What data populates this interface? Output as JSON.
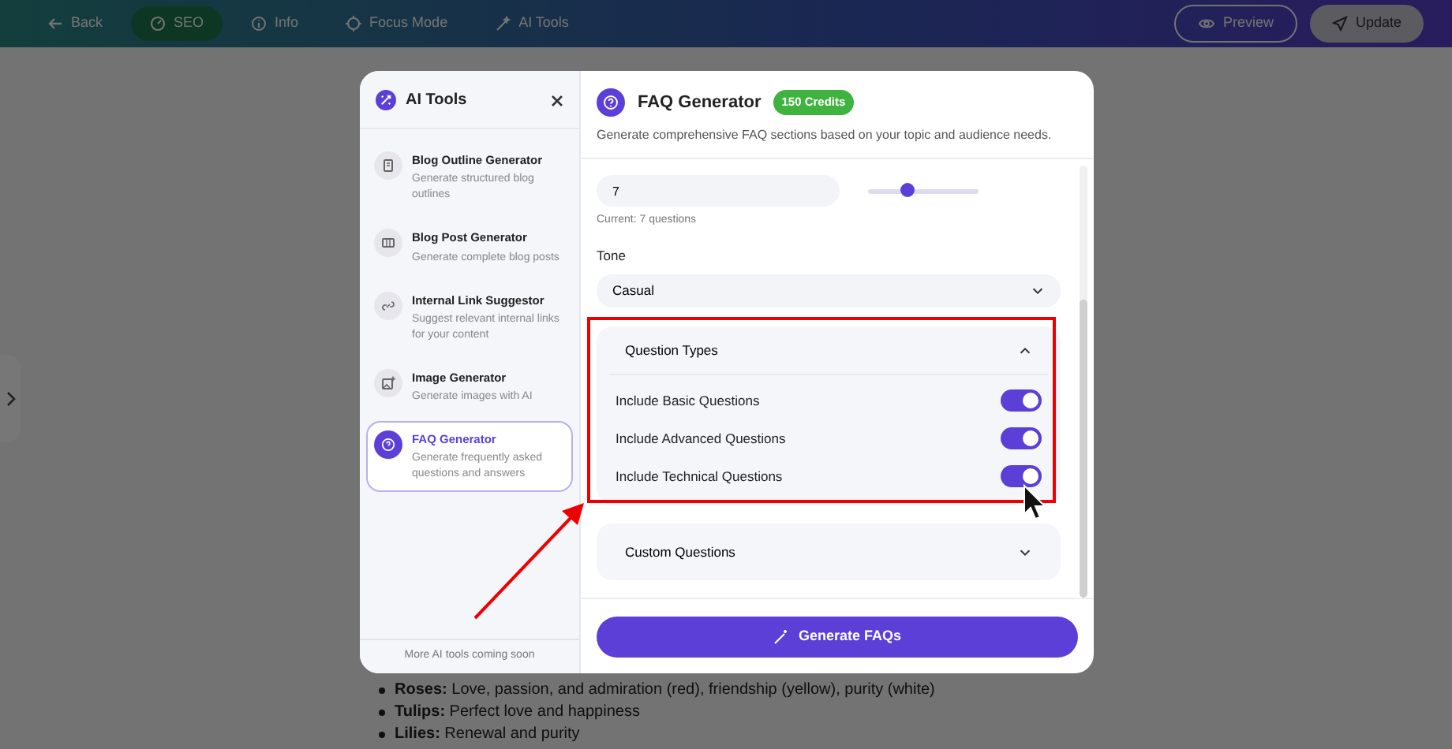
{
  "topbar": {
    "items": [
      {
        "label": "Back",
        "kind": "back",
        "selected": false
      },
      {
        "label": "SEO",
        "kind": "gauge",
        "selected": true
      },
      {
        "label": "Info",
        "kind": "info",
        "selected": false
      },
      {
        "label": "Focus Mode",
        "kind": "focus",
        "selected": false
      },
      {
        "label": "AI Tools",
        "kind": "wand",
        "selected": false
      }
    ],
    "preview": "Preview",
    "update": "Update"
  },
  "document": {
    "bullets": [
      "**Roses:** Love, passion, and admiration (red), friendship (yellow), purity (white)",
      "**Tulips:** Perfect love and happiness",
      "**Lilies:** Renewal and purity"
    ]
  },
  "ai_tools": {
    "title": "AI Tools",
    "tools": [
      {
        "title": "Blog Outline Generator",
        "description": "Generate structured blog outlines",
        "kind": "outline",
        "selected": false
      },
      {
        "title": "Blog Post Generator",
        "description": "Generate complete blog posts",
        "kind": "post",
        "selected": false
      },
      {
        "title": "Internal Link Suggestor",
        "description": "Suggest relevant internal links for your content",
        "kind": "link",
        "selected": false
      },
      {
        "title": "Image Generator",
        "description": "Generate images with AI",
        "kind": "image",
        "selected": false
      },
      {
        "title": "FAQ Generator",
        "description": "Generate frequently asked questions and answers",
        "kind": "faq",
        "selected": true
      }
    ],
    "footer": "More AI tools coming soon"
  },
  "faq": {
    "title": "FAQ Generator",
    "badge": "150 Credits",
    "description": "Generate comprehensive FAQ sections based on your topic and audience needs.",
    "count": {
      "value": "7",
      "level": 0.36,
      "hint": "Current: 7 questions"
    },
    "tone": {
      "label": "Tone",
      "value": "Casual"
    },
    "sections": [
      {
        "title": "Question Types",
        "expanded": true,
        "options": [
          {
            "label": "Include Basic Questions",
            "on": true
          },
          {
            "label": "Include Advanced Questions",
            "on": true
          },
          {
            "label": "Include Technical Questions",
            "on": true
          }
        ]
      },
      {
        "title": "Custom Questions",
        "expanded": false
      }
    ],
    "button": "Generate FAQs"
  }
}
